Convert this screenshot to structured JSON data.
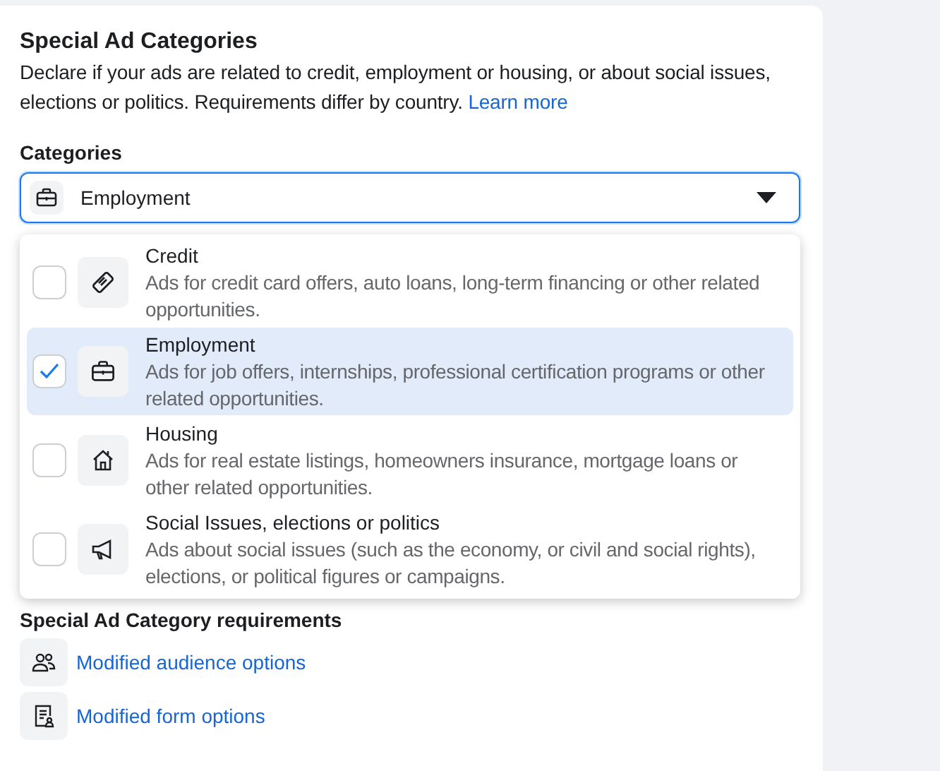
{
  "section": {
    "title": "Special Ad Categories",
    "description": "Declare if your ads are related to credit, employment or housing, or about social issues, elections or politics. Requirements differ by country.",
    "learn_more": "Learn more"
  },
  "categories": {
    "label": "Categories",
    "value": "Employment",
    "expanded": true
  },
  "options": [
    {
      "title": "Credit",
      "description": "Ads for credit card offers, auto loans, long-term financing or other related opportunities.",
      "checked": false,
      "selected": false
    },
    {
      "title": "Employment",
      "description": "Ads for job offers, internships, professional certification programs or other related opportunities.",
      "checked": true,
      "selected": true
    },
    {
      "title": "Housing",
      "description": "Ads for real estate listings, homeowners insurance, mortgage loans or other related opportunities.",
      "checked": false,
      "selected": false
    },
    {
      "title": "Social Issues, elections or politics",
      "description": "Ads about social issues (such as the economy, or civil and social rights), elections, or political figures or campaigns.",
      "checked": false,
      "selected": false
    }
  ],
  "requirements": {
    "title": "Special Ad Category requirements",
    "items": [
      {
        "label": "Modified audience options"
      },
      {
        "label": "Modified form options"
      }
    ]
  }
}
